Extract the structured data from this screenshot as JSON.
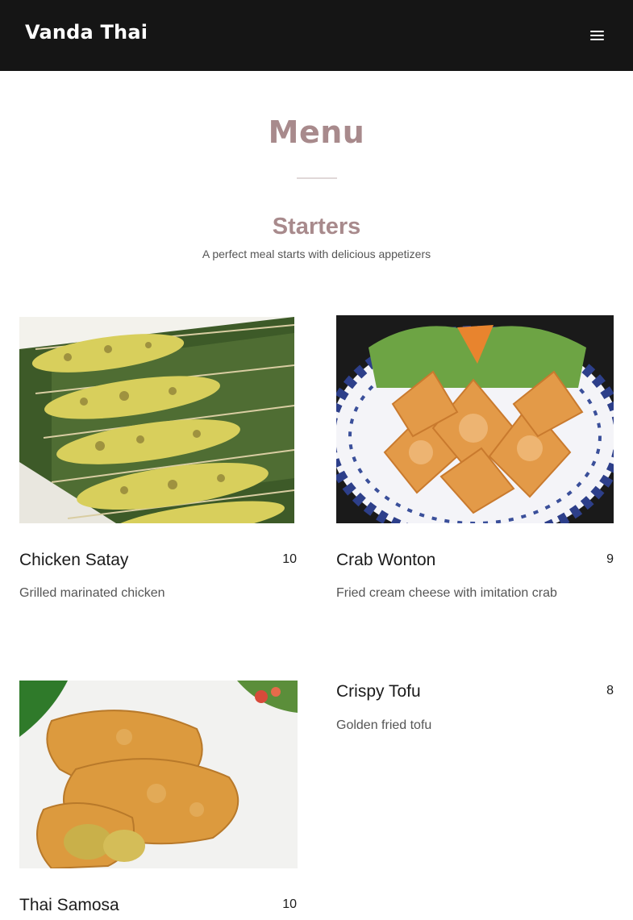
{
  "header": {
    "logo": "Vanda Thai",
    "menu_icon": "hamburger-menu-icon"
  },
  "page": {
    "title": "Menu"
  },
  "section": {
    "title": "Starters",
    "subtitle": "A perfect meal starts with delicious appetizers"
  },
  "items": [
    {
      "name": "Chicken Satay",
      "price": "10",
      "description": "Grilled marinated chicken",
      "image": "chicken-satay-photo"
    },
    {
      "name": "Crab Wonton",
      "price": "9",
      "description": "Fried cream cheese with imitation crab",
      "image": "crab-wonton-photo"
    },
    {
      "name": "Crispy Tofu",
      "price": "8",
      "description": "Golden fried tofu"
    },
    {
      "name": "Thai Samosa",
      "price": "10",
      "description": "",
      "image": "thai-samosa-photo"
    }
  ],
  "colors": {
    "header_bg": "#151515",
    "accent": "#a88a8c"
  }
}
